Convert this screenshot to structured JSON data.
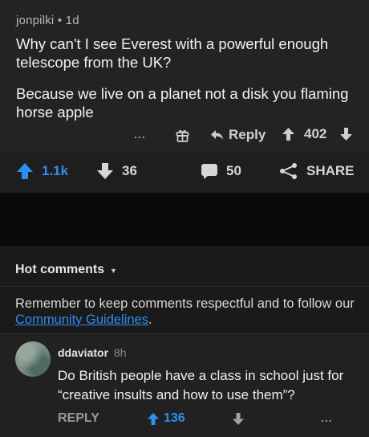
{
  "comment": {
    "author": "jonpilki",
    "age": "1d",
    "paragraphs": [
      "Why can't I see Everest with a powerful enough telescope from the UK?",
      "Because we live on a planet not a disk you flaming horse apple"
    ],
    "actions": {
      "more": "...",
      "gift_icon": "gift-icon",
      "reply_label": "Reply",
      "score": "402"
    }
  },
  "post_bar": {
    "upvotes": "1.1k",
    "downvotes": "36",
    "comments": "50",
    "share_label": "SHARE"
  },
  "comments_section": {
    "sort_label": "Hot comments",
    "guidelines_prefix": "Remember to keep comments respectful and to follow our ",
    "guidelines_link": "Community Guidelines",
    "guidelines_suffix": "."
  },
  "reply_comment": {
    "author": "ddaviator",
    "age": "8h",
    "text": "Do British people have a class in school just for “creative insults and how to use them”?",
    "reply_label": "REPLY",
    "upvotes": "136",
    "more": "..."
  },
  "colors": {
    "accent_blue": "#2f8ef2",
    "background": "#1a1a1b",
    "card": "#232323"
  }
}
